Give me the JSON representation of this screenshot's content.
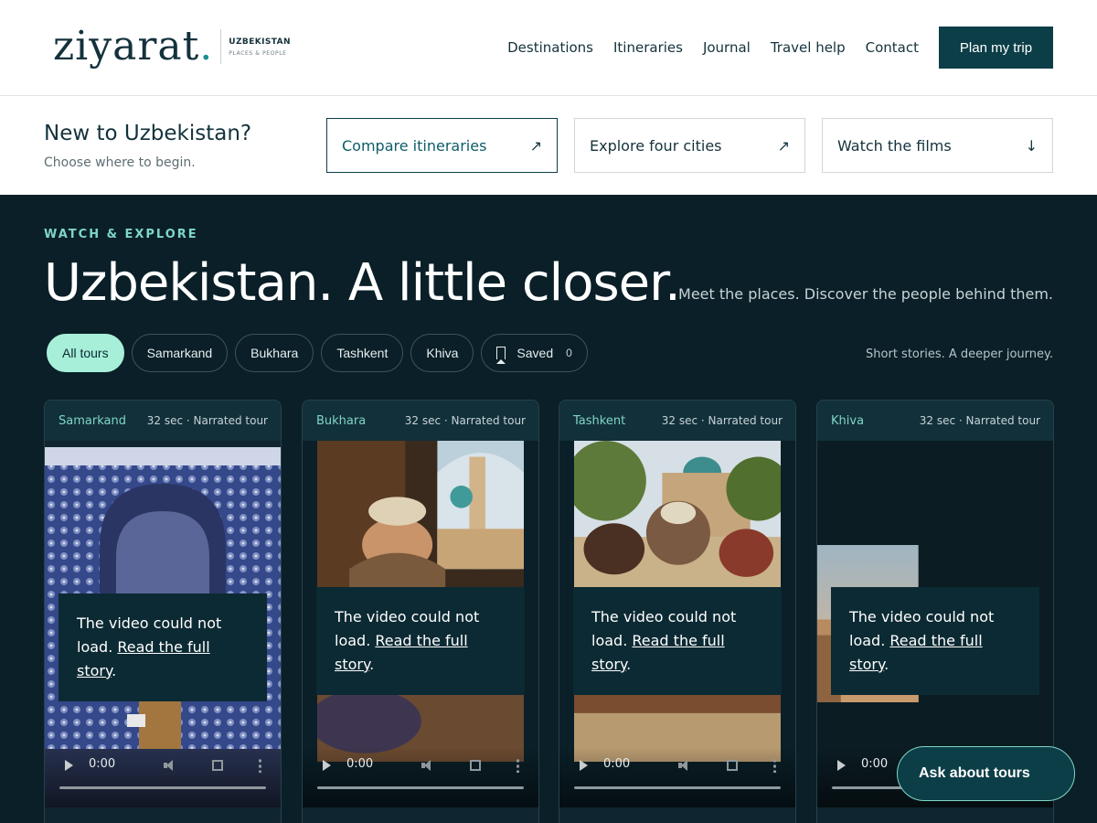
{
  "header": {
    "logo_word": "ziyarat",
    "logo_dot": ".",
    "logo_tag_top": "UZBEKISTAN",
    "logo_tag_bottom": "PLACES & PEOPLE",
    "nav": [
      "Destinations",
      "Itineraries",
      "Journal",
      "Travel help",
      "Contact"
    ],
    "cta": "Plan my trip"
  },
  "intro": {
    "title": "New to Uzbekistan?",
    "subtitle": "Choose where to begin.",
    "links": [
      {
        "label": "Compare itineraries",
        "icon": "arrow-up-right-icon",
        "arrow": "↗"
      },
      {
        "label": "Explore four cities",
        "icon": "arrow-up-right-icon",
        "arrow": "↗"
      },
      {
        "label": "Watch the films",
        "icon": "arrow-down-icon",
        "arrow": "↓"
      }
    ]
  },
  "hero": {
    "eyebrow": "WATCH & EXPLORE",
    "title": "Uzbekistan. A little closer.",
    "subtitle": "Meet the places. Discover the people behind them.",
    "tagline": "Short stories. A deeper journey."
  },
  "filters": {
    "chips": [
      "All tours",
      "Samarkand",
      "Bukhara",
      "Tashkent",
      "Khiva"
    ],
    "saved_label": "Saved",
    "saved_count": "0"
  },
  "cards": [
    {
      "city": "Samarkand",
      "meta": "32 sec · Narrated tour",
      "error_text": "The video could not load.",
      "error_link": "Read the full story",
      "time": "0:00"
    },
    {
      "city": "Bukhara",
      "meta": "32 sec · Narrated tour",
      "error_text": "The video could not load.",
      "error_link": "Read the full story",
      "time": "0:00"
    },
    {
      "city": "Tashkent",
      "meta": "32 sec · Narrated tour",
      "error_text": "The video could not load.",
      "error_link": "Read the full story",
      "time": "0:00"
    },
    {
      "city": "Khiva",
      "meta": "32 sec · Narrated tour",
      "error_text": "The video could not load.",
      "error_link": "Read the full story",
      "time": "0:00"
    }
  ],
  "chat": {
    "label": "Ask about tours"
  },
  "colors": {
    "brand": "#0c3e48",
    "accent": "#7fd6c6",
    "chip_active": "#a7efd9",
    "dark_bg": "#0a1f27"
  }
}
